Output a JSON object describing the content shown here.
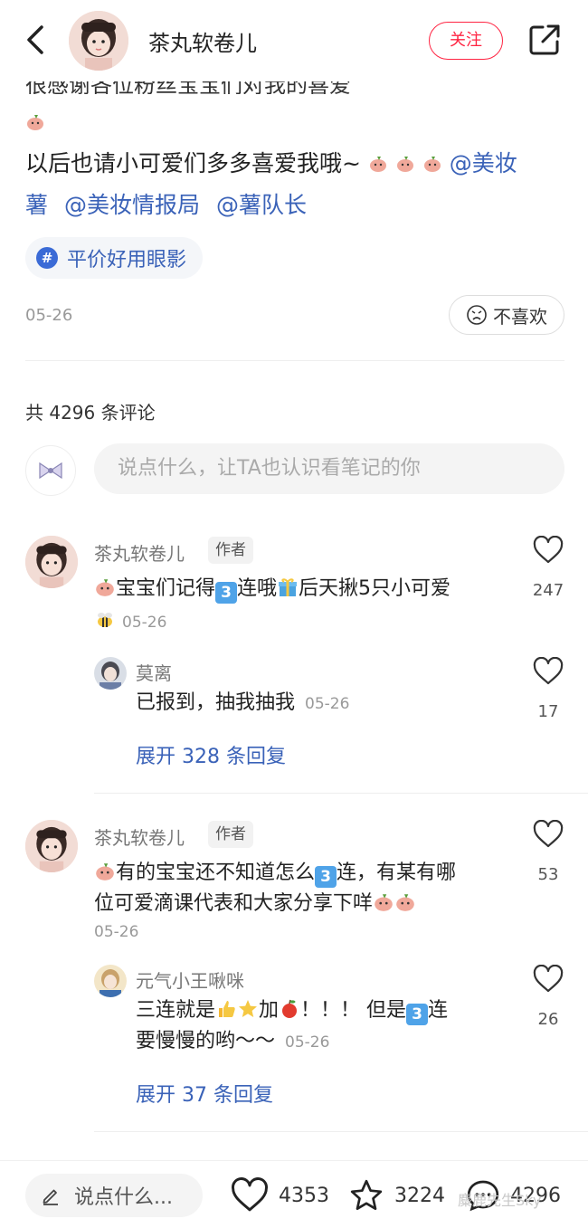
{
  "header": {
    "author_name": "茶丸软卷儿",
    "follow_label": "关注"
  },
  "post": {
    "line_cutoff": "很感谢各位粉丝宝宝们对我的喜爱",
    "line1": "以后也请小可爱们多多喜爱我哦~",
    "mention1": "@美妆",
    "mention1b": "薯",
    "mention2": "@美妆情报局",
    "mention3": "@薯队长",
    "topic": "平价好用眼影",
    "date": "05-26",
    "dislike_label": "不喜欢"
  },
  "comments_header": {
    "count_text": "共 4296 条评论",
    "input_placeholder": "说点什么，让TA也认识看笔记的你"
  },
  "comments": [
    {
      "name": "茶丸软卷儿",
      "tag": "作者",
      "text_a": "宝宝们记得",
      "text_b": "连哦",
      "text_c": "后天揪5只小可爱",
      "date": "05-26",
      "likes": "247",
      "reply": {
        "name": "莫离",
        "text": "已报到，抽我抽我",
        "time": "05-26",
        "likes": "17"
      },
      "expand": "展开 328 条回复"
    },
    {
      "name": "茶丸软卷儿",
      "tag": "作者",
      "text_a": "有的宝宝还不知道怎么",
      "text_b": "连，有某有哪",
      "text_line2": "位可爱滴课代表和大家分享下咩",
      "date": "05-26",
      "likes": "53",
      "reply": {
        "name": "元气小王啾咪",
        "text_a": "三连就是",
        "text_b": "加",
        "text_c": "！！！ 但是",
        "text_d": "连",
        "text_line2": "要慢慢的哟～～",
        "time": "05-26",
        "likes": "26"
      },
      "expand": "展开 37 条回复"
    }
  ],
  "bottom_bar": {
    "input_label": "说点什么...",
    "likes": "4353",
    "stars": "3224",
    "comments": "4296",
    "watermark": "麋鹿先生Sky"
  },
  "icons": {
    "back": "chevron-left-icon",
    "share": "share-icon",
    "heart": "heart-icon",
    "star": "star-icon",
    "comment": "comment-bubble-icon",
    "pencil": "pencil-icon",
    "sad_face": "sad-face-icon",
    "hashtag": "hashtag-icon",
    "bow": "bow-icon"
  },
  "colors": {
    "accent_red": "#ff2442",
    "link_blue": "#3a62b8"
  }
}
